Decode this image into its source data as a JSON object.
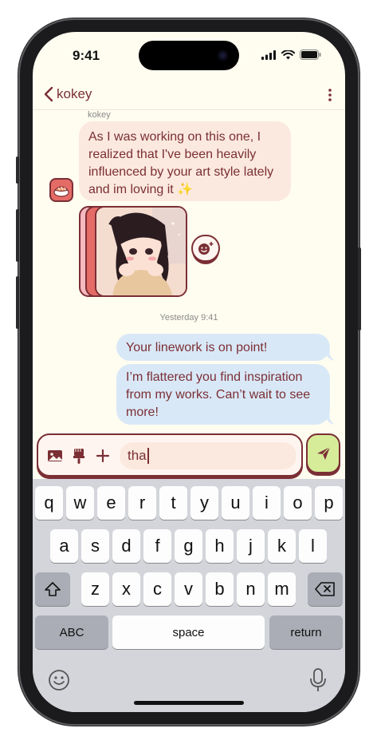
{
  "status": {
    "time": "9:41"
  },
  "header": {
    "back_label": "kokey"
  },
  "conversation": {
    "sender_name": "kokey",
    "incoming_message": "As I was working on this one, I realized that I've been heavily influenced by your art style lately and im loving it ✨",
    "timestamp": "Yesterday 9:41",
    "outgoing_messages": [
      "Your linework is on point!",
      "I’m flattered you find inspiration from my works. Can’t wait to see more!"
    ]
  },
  "composer": {
    "input_value": "tha"
  },
  "keyboard": {
    "row1": [
      "q",
      "w",
      "e",
      "r",
      "t",
      "y",
      "u",
      "i",
      "o",
      "p"
    ],
    "row2": [
      "a",
      "s",
      "d",
      "f",
      "g",
      "h",
      "j",
      "k",
      "l"
    ],
    "row3": [
      "z",
      "x",
      "c",
      "v",
      "b",
      "n",
      "m"
    ],
    "abc_label": "ABC",
    "space_label": "space",
    "return_label": "return"
  },
  "colors": {
    "accent": "#7b2f35",
    "incoming_bubble": "#fbe9df",
    "outgoing_bubble": "#d9e8f7",
    "send_button": "#d6ec99",
    "background": "#fffdf0"
  },
  "icons": [
    "chevron-left-icon",
    "more-vertical-icon",
    "image-icon",
    "brush-icon",
    "plus-icon",
    "send-icon",
    "emoji-react-icon",
    "shift-icon",
    "backspace-icon",
    "emoji-icon",
    "microphone-icon"
  ]
}
